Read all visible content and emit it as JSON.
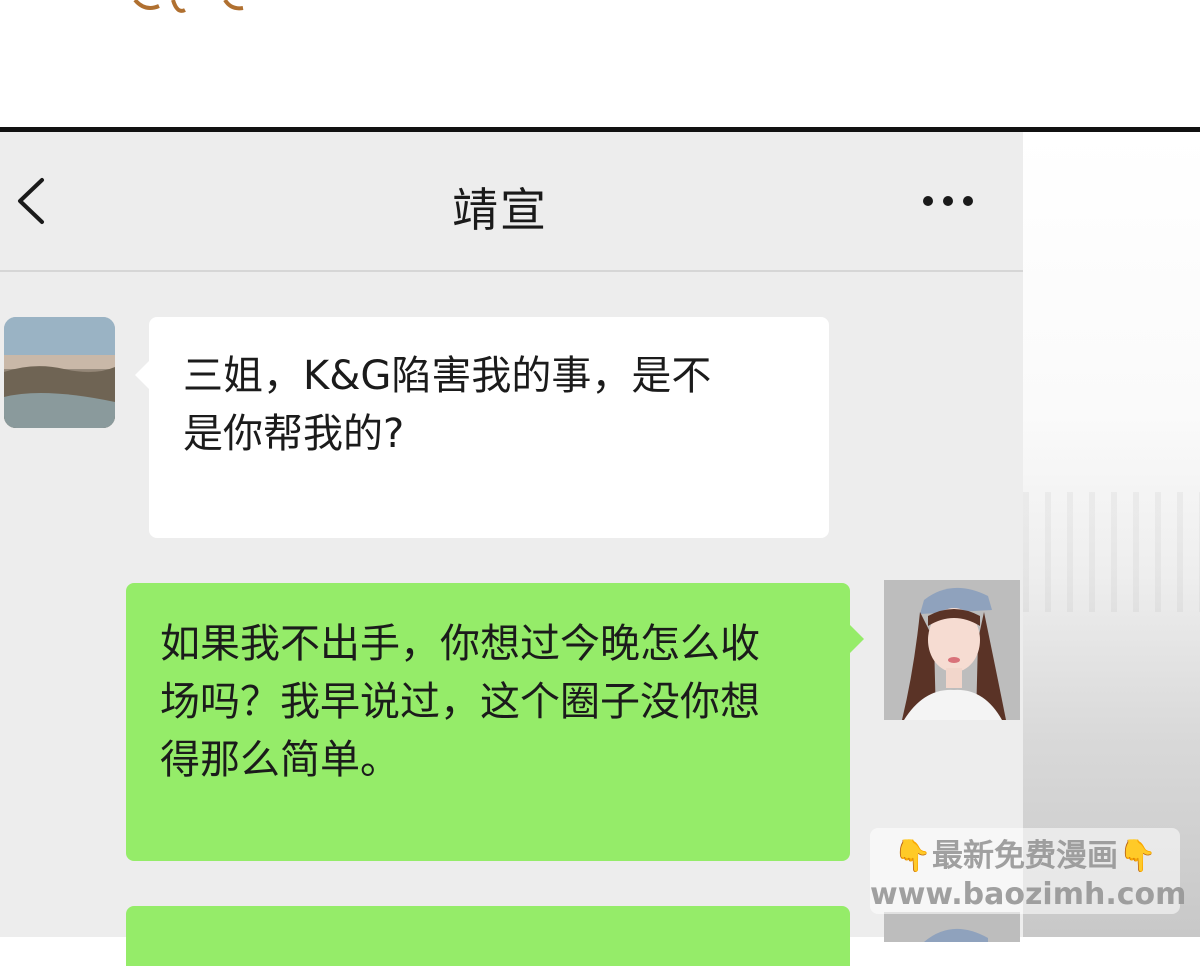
{
  "header": {
    "title": "靖宣"
  },
  "messages": [
    {
      "side": "incoming",
      "lines": [
        "三姐，K&G陷害我的事，是不",
        "是你帮我的?"
      ]
    },
    {
      "side": "outgoing",
      "lines": [
        "如果我不出手，你想过今晚怎么收",
        "场吗？我早说过，这个圈子没你想",
        "得那么简单。"
      ]
    }
  ],
  "watermark": {
    "hand_icon": "👇",
    "line1": "最新免费漫画",
    "line2": "www.baozimh.com"
  },
  "colors": {
    "chat_bg": "#ededed",
    "incoming_bubble": "#ffffff",
    "outgoing_bubble": "#95ec69"
  },
  "icons": {
    "back": "chevron-left-icon",
    "more": "more-dots-icon"
  }
}
